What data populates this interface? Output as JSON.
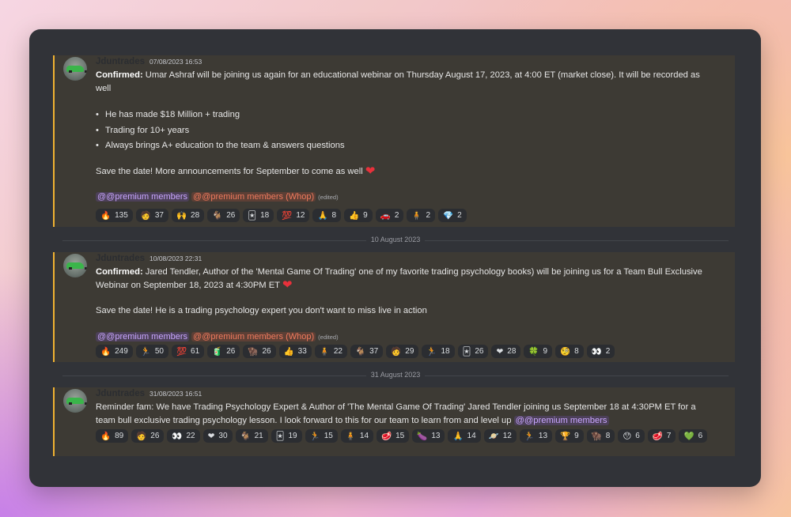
{
  "messages": [
    {
      "username": "Jduntrades",
      "timestamp": "07/08/2023 16:53",
      "confirmed_label": "Confirmed:",
      "text1": " Umar Ashraf will be joining us again for an educational webinar on Thursday August 17, 2023, at 4:00 ET (market close). It will be recorded as well",
      "bullets": [
        "He has made $18 Million + trading",
        "Trading for 10+ years",
        "Always brings A+ education to the team & answers questions"
      ],
      "text2": "Save the date! More announcements for September to come as well",
      "mention1": "@@premium members",
      "mention2": "@@premium members (Whop)",
      "edited": "(edited)",
      "reactions": [
        {
          "emoji": "🔥",
          "count": "135"
        },
        {
          "emoji": "🧑",
          "count": "37"
        },
        {
          "emoji": "🙌",
          "count": "28"
        },
        {
          "emoji": "🐐",
          "count": "26"
        },
        {
          "emoji": "🃏",
          "count": "18"
        },
        {
          "emoji": "💯",
          "count": "12"
        },
        {
          "emoji": "🙏",
          "count": "8"
        },
        {
          "emoji": "👍",
          "count": "9"
        },
        {
          "emoji": "🚗",
          "count": "2"
        },
        {
          "emoji": "🧍",
          "count": "2"
        },
        {
          "emoji": "💎",
          "count": "2"
        }
      ]
    },
    {
      "username": "Jduntrades",
      "timestamp": "10/08/2023 22:31",
      "confirmed_label": "Confirmed:",
      "text1": " Jared Tendler, Author of  the 'Mental Game Of Trading' one of my favorite trading psychology books) will be joining us for a Team Bull Exclusive Webinar on September 18, 2023 at 4:30PM ET",
      "text2": "Save the date! He is a trading psychology expert you don't want to miss live in action",
      "mention1": "@@premium members",
      "mention2": "@@premium members (Whop)",
      "edited": "(edited)",
      "reactions": [
        {
          "emoji": "🔥",
          "count": "249"
        },
        {
          "emoji": "🏃",
          "count": "50"
        },
        {
          "emoji": "💯",
          "count": "61"
        },
        {
          "emoji": "🧃",
          "count": "26"
        },
        {
          "emoji": "🦬",
          "count": "26"
        },
        {
          "emoji": "👍",
          "count": "33"
        },
        {
          "emoji": "🧍",
          "count": "22"
        },
        {
          "emoji": "🐐",
          "count": "37"
        },
        {
          "emoji": "🧑",
          "count": "29"
        },
        {
          "emoji": "🏃",
          "count": "18"
        },
        {
          "emoji": "🃏",
          "count": "26"
        },
        {
          "emoji": "❤",
          "count": "28"
        },
        {
          "emoji": "🍀",
          "count": "9"
        },
        {
          "emoji": "🧐",
          "count": "8"
        },
        {
          "emoji": "👀",
          "count": "2"
        }
      ]
    },
    {
      "username": "Jduntrades",
      "timestamp": "31/08/2023 16:51",
      "text1": "Reminder fam: We have Trading Psychology Expert & Author of  'The Mental Game Of Trading' Jared Tendler joining us September 18 at 4:30PM ET for a team bull exclusive trading psychology lesson. I look forward to this for our team to learn from and level up ",
      "mention1": "@@premium members",
      "reactions": [
        {
          "emoji": "🔥",
          "count": "89"
        },
        {
          "emoji": "🧑",
          "count": "26"
        },
        {
          "emoji": "👀",
          "count": "22"
        },
        {
          "emoji": "❤",
          "count": "30"
        },
        {
          "emoji": "🐐",
          "count": "21"
        },
        {
          "emoji": "🃏",
          "count": "19"
        },
        {
          "emoji": "🏃",
          "count": "15"
        },
        {
          "emoji": "🧍",
          "count": "14"
        },
        {
          "emoji": "🥩",
          "count": "15"
        },
        {
          "emoji": "🍆",
          "count": "13"
        },
        {
          "emoji": "🙏",
          "count": "14"
        },
        {
          "emoji": "🪐",
          "count": "12"
        },
        {
          "emoji": "🏃",
          "count": "13"
        },
        {
          "emoji": "🏆",
          "count": "9"
        },
        {
          "emoji": "🦬",
          "count": "8"
        },
        {
          "emoji": "😯",
          "count": "6"
        },
        {
          "emoji": "🥩",
          "count": "7"
        },
        {
          "emoji": "💚",
          "count": "6"
        }
      ]
    }
  ],
  "dividers": [
    "10 August 2023",
    "31 August 2023"
  ],
  "colors": {
    "accent_bar": "#f0b232",
    "message_bg": "#3d3a34",
    "window_bg": "#313338",
    "mention": "#c9a6ff",
    "mention_red": "#f07b5e"
  }
}
